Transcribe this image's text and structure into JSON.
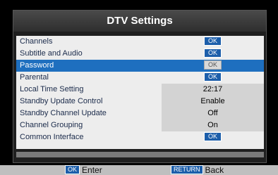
{
  "title": "DTV Settings",
  "menu": {
    "items": [
      {
        "label": "Channels",
        "value": "OK",
        "type": "ok",
        "selected": false
      },
      {
        "label": "Subtitle and Audio",
        "value": "OK",
        "type": "ok",
        "selected": false
      },
      {
        "label": "Password",
        "value": "OK",
        "type": "ok",
        "selected": true
      },
      {
        "label": "Parental",
        "value": "OK",
        "type": "ok",
        "selected": false
      },
      {
        "label": "Local Time Setting",
        "value": "22:17",
        "type": "text",
        "selected": false
      },
      {
        "label": "Standby Update Control",
        "value": "Enable",
        "type": "text",
        "selected": false
      },
      {
        "label": "Standby Channel Update",
        "value": "Off",
        "type": "text",
        "selected": false
      },
      {
        "label": "Channel Grouping",
        "value": "On",
        "type": "text",
        "selected": false
      },
      {
        "label": "Common Interface",
        "value": "OK",
        "type": "ok",
        "selected": false
      }
    ]
  },
  "footer": {
    "enter_key": "OK",
    "enter_label": "Enter",
    "back_key": "RETURN",
    "back_label": "Back"
  },
  "colors": {
    "selected_row": "#1e6fbf",
    "ok_badge": "#1c5eaa"
  }
}
